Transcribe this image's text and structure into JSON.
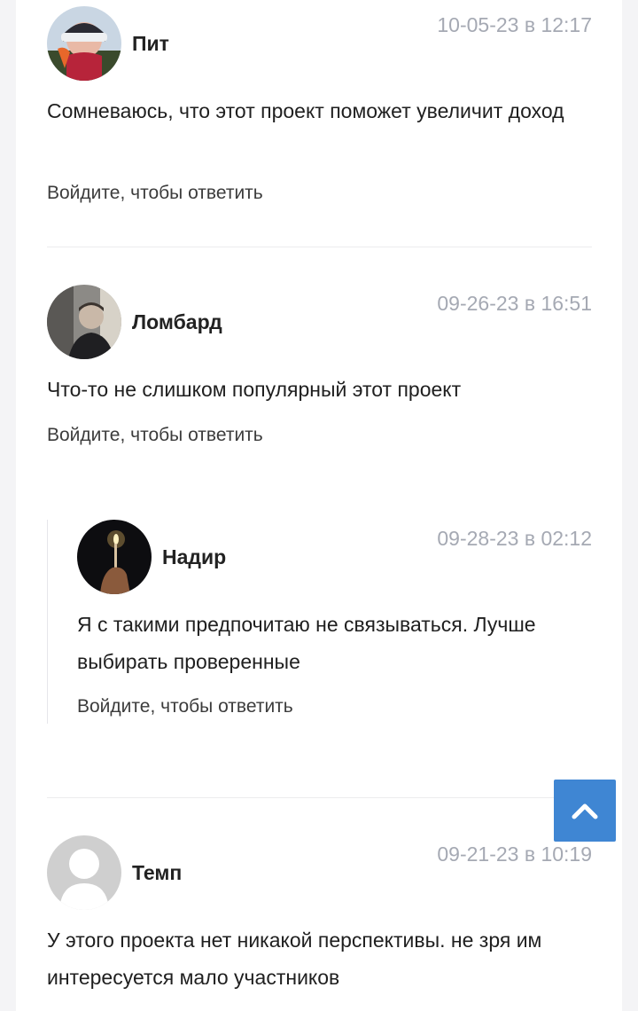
{
  "comments": [
    {
      "author": "Пит",
      "date": "10-05-23 в 12:17",
      "text": "Сомневаюсь, что этот проект поможет увеличит доход",
      "reply_link": "Войдите, чтобы ответить"
    },
    {
      "author": "Ломбард",
      "date": "09-26-23 в 16:51",
      "text": "Что-то не слишком популярный этот проект",
      "reply_link": "Войдите, чтобы ответить"
    },
    {
      "author": "Надир",
      "date": "09-28-23 в 02:12",
      "text": "Я с такими предпочитаю не связываться. Лучше выбирать проверенные",
      "reply_link": "Войдите, чтобы ответить"
    },
    {
      "author": "Темп",
      "date": "09-21-23 в 10:19",
      "text": "У этого проекта нет никакой перспективы. не зря им интересуется мало участников"
    }
  ],
  "scroll_top_button": {
    "icon": "chevron-up-icon",
    "color": "#3f86d3"
  },
  "colors": {
    "date_text": "#a5a9b3",
    "author_text": "#222222",
    "body_text": "#1f1f1f"
  }
}
